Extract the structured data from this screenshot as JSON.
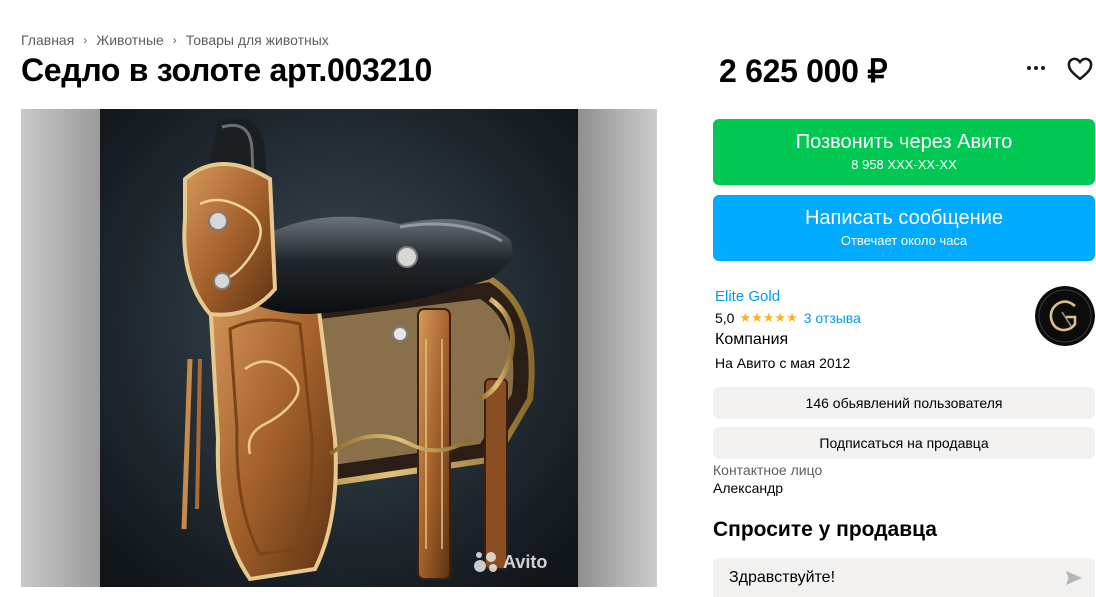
{
  "breadcrumbs": [
    "Главная",
    "Животные",
    "Товары для животных"
  ],
  "title": "Седло в золоте арт.003210",
  "price": "2 625 000 ₽",
  "icons": {
    "more": "more-dots-icon",
    "favorite": "heart-icon",
    "send": "send-icon"
  },
  "gallery": {
    "watermark": "Avito"
  },
  "call_button": {
    "label": "Позвонить через Авито",
    "phone": "8 958 XXX-XX-XX",
    "color": "#00c853"
  },
  "message_button": {
    "label": "Написать сообщение",
    "subtitle": "Отвечает около часа",
    "color": "#00aaff"
  },
  "seller": {
    "name": "Elite Gold",
    "rating": "5,0",
    "stars": 5,
    "reviews": "3 отзыва",
    "type": "Компания",
    "since": "На Авито с мая 2012"
  },
  "ads_button": "146 обьявлений пользователя",
  "subscribe_button": "Подписаться на продавца",
  "contact": {
    "label": "Контактное лицо",
    "name": "Александр"
  },
  "ask": {
    "title": "Спросите у продавца",
    "message": "Здравствуйте!"
  },
  "colors": {
    "link": "#0099f7",
    "star": "#ffb021",
    "pill_bg": "#f2f1f0"
  }
}
